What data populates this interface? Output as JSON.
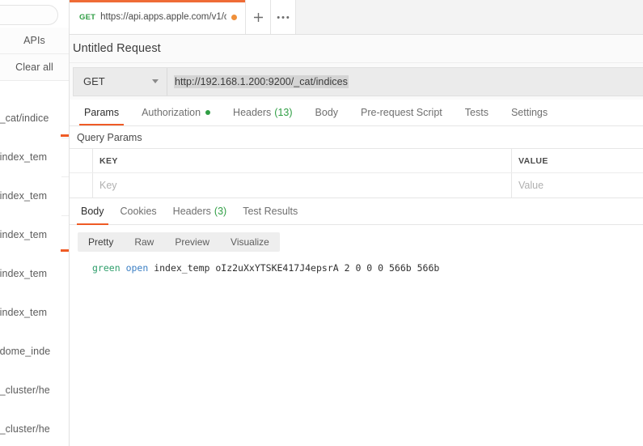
{
  "sidebar": {
    "search": {
      "value": "",
      "placeholder": ""
    },
    "buttons": {
      "apis": "APIs",
      "clear_all": "Clear all"
    },
    "items": [
      {
        "label": "/_cat/indice"
      },
      {
        "label": "/index_tem"
      },
      {
        "label": "/index_tem"
      },
      {
        "label": "/index_tem"
      },
      {
        "label": "/index_tem"
      },
      {
        "label": "/index_tem"
      },
      {
        "label": "/dome_inde"
      },
      {
        "label": "/_cluster/he"
      },
      {
        "label": "/_cluster/he"
      }
    ]
  },
  "tabstrip": {
    "request_tab": {
      "method": "GET",
      "url": "https://api.apps.apple.com/v1/c…",
      "unsaved": true
    },
    "new_tab_label": "+",
    "more_label": "•••"
  },
  "request": {
    "title": "Untitled Request",
    "method": "GET",
    "url": "http://192.168.1.200:9200/_cat/indices",
    "tabs": [
      {
        "label": "Params",
        "active": true,
        "count": "",
        "dot": false
      },
      {
        "label": "Authorization",
        "active": false,
        "count": "",
        "dot": true
      },
      {
        "label": "Headers",
        "active": false,
        "count": "(13)",
        "dot": false
      },
      {
        "label": "Body",
        "active": false,
        "count": "",
        "dot": false
      },
      {
        "label": "Pre-request Script",
        "active": false,
        "count": "",
        "dot": false
      },
      {
        "label": "Tests",
        "active": false,
        "count": "",
        "dot": false
      },
      {
        "label": "Settings",
        "active": false,
        "count": "",
        "dot": false
      }
    ],
    "query_params": {
      "title": "Query Params",
      "columns": {
        "key": "KEY",
        "value": "VALUE"
      },
      "rows": [
        {
          "key_placeholder": "Key",
          "value_placeholder": "Value"
        }
      ]
    }
  },
  "response": {
    "tabs": [
      {
        "label": "Body",
        "active": true,
        "count": ""
      },
      {
        "label": "Cookies",
        "active": false,
        "count": ""
      },
      {
        "label": "Headers",
        "active": false,
        "count": "(3)"
      },
      {
        "label": "Test Results",
        "active": false,
        "count": ""
      }
    ],
    "formats": [
      {
        "label": "Pretty",
        "active": true
      },
      {
        "label": "Raw",
        "active": false
      },
      {
        "label": "Preview",
        "active": false
      },
      {
        "label": "Visualize",
        "active": false
      }
    ],
    "body_tokens": [
      {
        "text": "green",
        "color": "green"
      },
      {
        "text": " ",
        "color": "dark"
      },
      {
        "text": "open",
        "color": "blue"
      },
      {
        "text": " index_temp oIz2uXxYTSKE417J4epsrA 2 0 0 0 566b 566b",
        "color": "dark"
      }
    ]
  },
  "colors": {
    "accent_orange": "#ef5b25",
    "method_green": "#2f9e44",
    "token_green": "#2e9e6b",
    "token_blue": "#3b7fc4",
    "unsaved_dot": "#f0903a"
  }
}
